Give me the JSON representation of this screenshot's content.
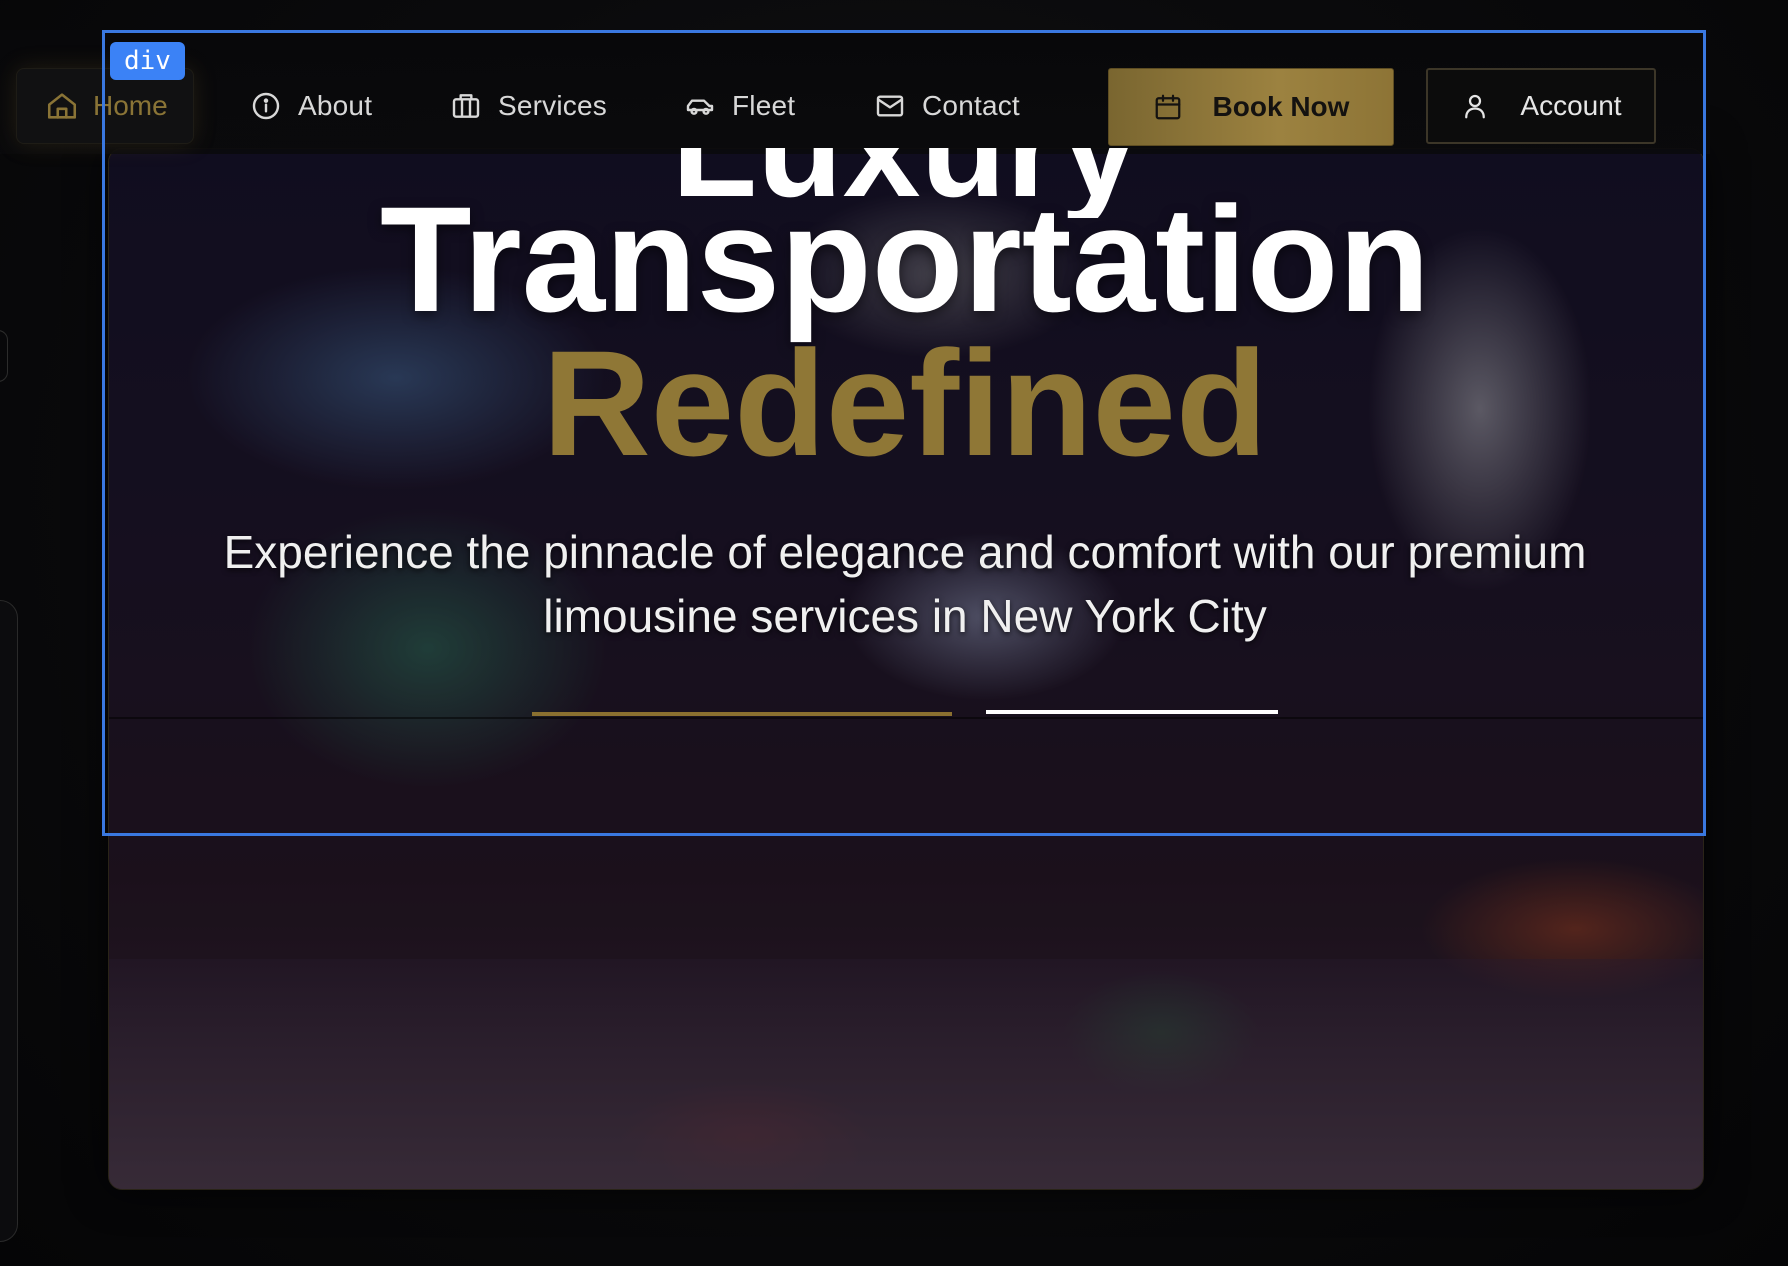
{
  "nav": {
    "home": {
      "label": "Home",
      "icon": "home-icon"
    },
    "items": [
      {
        "label": "About",
        "icon": "info-icon"
      },
      {
        "label": "Services",
        "icon": "briefcase-icon"
      },
      {
        "label": "Fleet",
        "icon": "car-icon"
      },
      {
        "label": "Contact",
        "icon": "mail-icon"
      }
    ],
    "book": {
      "label": "Book Now",
      "icon": "calendar-icon"
    },
    "account": {
      "label": "Account",
      "icon": "user-icon"
    }
  },
  "devtools": {
    "tag": "div",
    "highlight_color": "#3b82f6"
  },
  "hero": {
    "title_line1": "Luxury",
    "title_line2": "Transportation",
    "title_line3": "Redefined",
    "subtitle": "Experience the pinnacle of elegance and comfort with our premium limousine services in New York City"
  },
  "colors": {
    "gold": "#8f7736",
    "accent_gold_button": "#9c8240",
    "background": "#07070a",
    "text": "#ffffff"
  }
}
